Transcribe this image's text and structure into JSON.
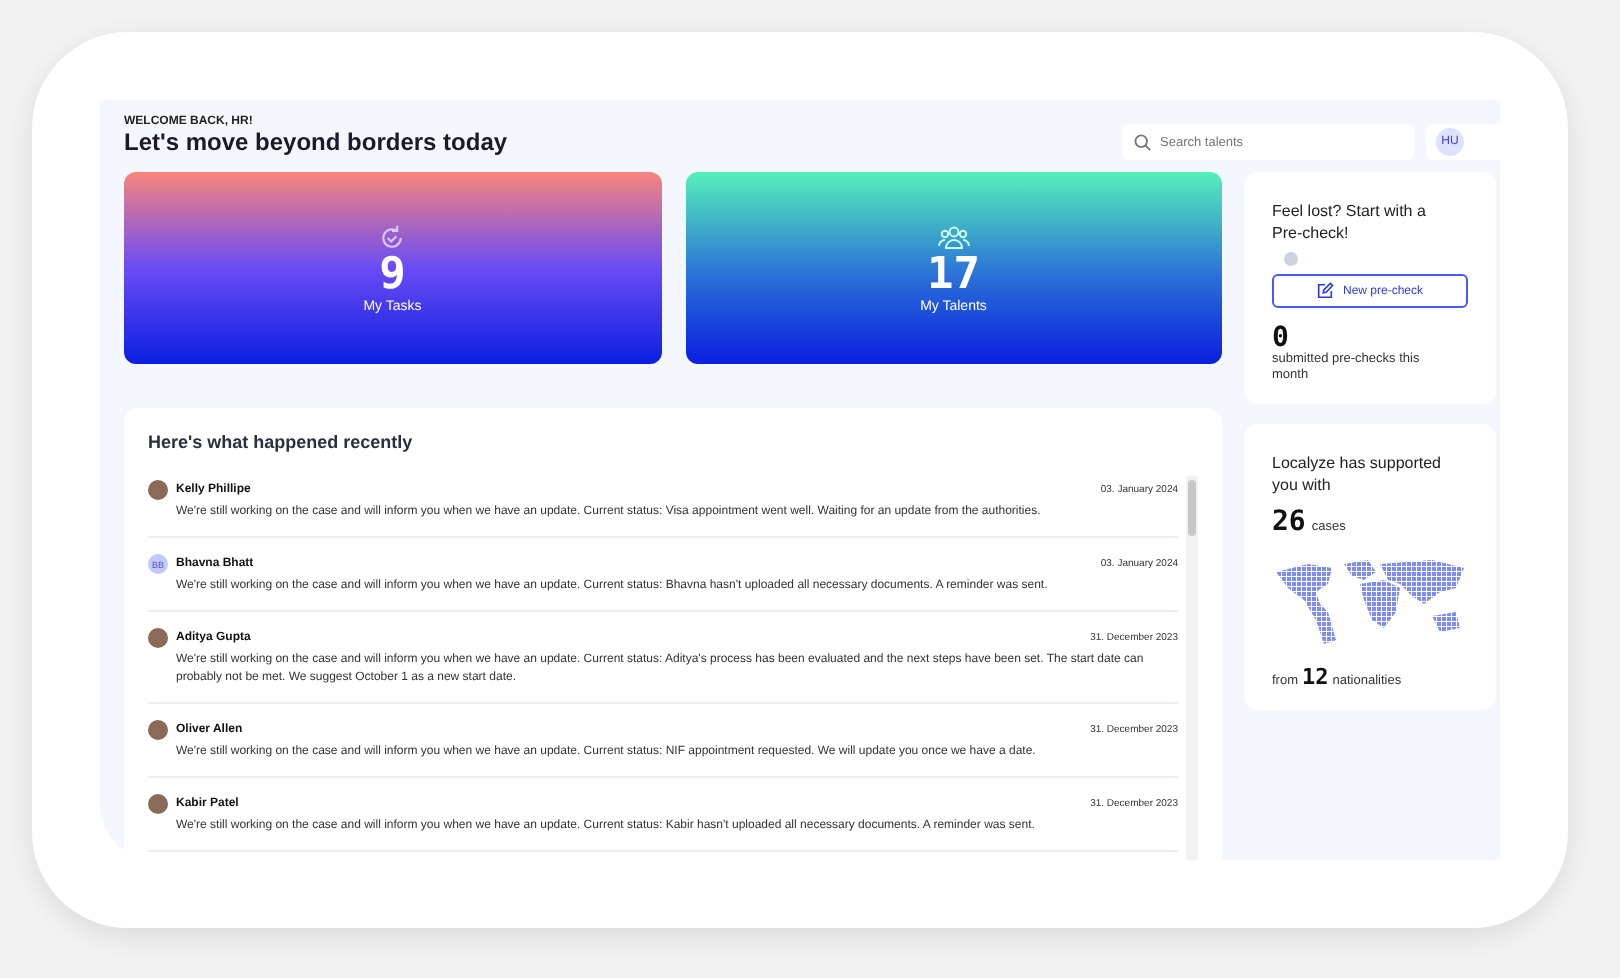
{
  "header": {
    "greeting": "WELCOME BACK, HR!",
    "title": "Let's move beyond borders today"
  },
  "search": {
    "placeholder": "Search talents"
  },
  "user": {
    "initials": "HU"
  },
  "stat_cards": [
    {
      "kind": "tasks",
      "value": "9",
      "label": "My Tasks"
    },
    {
      "kind": "talents",
      "value": "17",
      "label": "My Talents"
    }
  ],
  "activity": {
    "title": "Here's what happened recently",
    "items": [
      {
        "name": "Kelly Phillipe",
        "kind": "photo",
        "date": "03. January 2024",
        "message": "We're still working on the case and will inform you when we have an update. Current status: Visa appointment went well. Waiting for an update from the authorities."
      },
      {
        "name": "Bhavna Bhatt",
        "kind": "initials",
        "initials": "BB",
        "date": "03. January 2024",
        "message": "We're still working on the case and will inform you when we have an update. Current status: Bhavna hasn't uploaded all necessary documents. A reminder was sent."
      },
      {
        "name": "Aditya Gupta",
        "kind": "photo",
        "date": "31. December 2023",
        "message": "We're still working on the case and will inform you when we have an update. Current status: Aditya's process has been evaluated and the next steps have been set. The start date can probably not be met. We suggest October 1 as a new start date."
      },
      {
        "name": "Oliver Allen",
        "kind": "photo",
        "date": "31. December 2023",
        "message": "We're still working on the case and will inform you when we have an update. Current status: NIF appointment requested. We will update you once we have a date."
      },
      {
        "name": "Kabir Patel",
        "kind": "photo",
        "date": "31. December 2023",
        "message": "We're still working on the case and will inform you when we have an update. Current status: Kabir hasn't uploaded all necessary documents. A reminder was sent."
      }
    ]
  },
  "precheck": {
    "title": "Feel lost? Start with a Pre-check!",
    "button": "New pre-check",
    "count": "0",
    "caption": "submitted pre-checks this month"
  },
  "support": {
    "title": "Localyze has supported you with",
    "cases": "26",
    "cases_label": "cases",
    "from": "from",
    "nationalities": "12",
    "nationalities_label": "nationalities"
  }
}
